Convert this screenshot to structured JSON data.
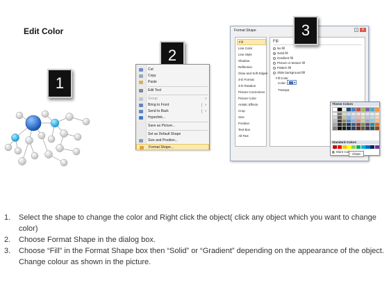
{
  "title": "Edit Color",
  "steps": [
    "1",
    "2",
    "3"
  ],
  "context_menu": {
    "items": [
      {
        "label": "Cut",
        "icon": "scissors-icon",
        "underline": "t"
      },
      {
        "label": "Copy",
        "icon": "copy-icon"
      },
      {
        "label": "Paste",
        "icon": "paste-icon"
      },
      {
        "label": "Edit Text",
        "icon": "edit-text-icon"
      },
      {
        "label": "Group",
        "icon": "group-icon",
        "submenu": true,
        "disabled": true
      },
      {
        "label": "Bring to Front",
        "icon": "bring-front-icon",
        "submenu": true
      },
      {
        "label": "Send to Back",
        "icon": "send-back-icon",
        "submenu": true
      },
      {
        "label": "Hyperlink...",
        "icon": "hyperlink-icon"
      },
      {
        "label": "Save as Picture...",
        "icon": ""
      },
      {
        "label": "Set as Default Shape",
        "icon": ""
      },
      {
        "label": "Size and Position...",
        "icon": "size-position-icon"
      },
      {
        "label": "Format Shape...",
        "icon": "format-shape-icon",
        "highlighted": true
      }
    ]
  },
  "dialog": {
    "title": "Format Shape",
    "help_label": "?",
    "close_glyph": "✕",
    "categories": [
      "Fill",
      "Line Color",
      "Line Style",
      "Shadow",
      "Reflection",
      "Glow and Soft Edges",
      "3-D Format",
      "3-D Rotation",
      "Picture Corrections",
      "Picture Color",
      "Artistic Effects",
      "Crop",
      "Size",
      "Position",
      "Text Box",
      "Alt Text"
    ],
    "selected_category": "Fill",
    "panel_heading": "Fill",
    "fill_options": [
      "No fill",
      "Solid fill",
      "Gradient fill",
      "Picture or texture fill",
      "Pattern fill",
      "Slide background fill"
    ],
    "selected_fill": "Solid fill",
    "fill_color_label": "Fill Color",
    "color_label": "Color:",
    "transparency_label": "Transpa",
    "popup": {
      "theme_colors_label": "Theme Colors",
      "standard_colors_label": "Standard Colors",
      "more_colors_label": "More Colors..."
    },
    "close_button": "Close"
  },
  "theme_colors": {
    "top": [
      "#ffffff",
      "#000000",
      "#eeece1",
      "#1f497d",
      "#4f81bd",
      "#c0504d",
      "#9bbb59",
      "#8064a2",
      "#4bacc6",
      "#f79646"
    ],
    "shades": [
      [
        "#f2f2f2",
        "#7f7f7f",
        "#ddd9c3",
        "#c6d9f0",
        "#dbe5f1",
        "#f2dcdb",
        "#ebf1dd",
        "#e5e0ec",
        "#dbeef3",
        "#fdeada"
      ],
      [
        "#d8d8d8",
        "#595959",
        "#c4bd97",
        "#8db3e2",
        "#b8cce4",
        "#e5b9b7",
        "#d7e3bc",
        "#ccc1d9",
        "#b7dde8",
        "#fbd5b5"
      ],
      [
        "#bfbfbf",
        "#3f3f3f",
        "#938953",
        "#548dd4",
        "#95b3d7",
        "#d99694",
        "#c3d69b",
        "#b2a2c7",
        "#92cddc",
        "#fac08f"
      ],
      [
        "#a5a5a5",
        "#262626",
        "#494429",
        "#17365d",
        "#366092",
        "#953734",
        "#76923c",
        "#5f497a",
        "#31859b",
        "#e36c09"
      ],
      [
        "#7f7f7f",
        "#0c0c0c",
        "#1d1b10",
        "#0f243e",
        "#244061",
        "#632423",
        "#4f6128",
        "#3f3151",
        "#205867",
        "#974806"
      ]
    ],
    "standard": [
      "#c00000",
      "#ff0000",
      "#ffc000",
      "#ffff00",
      "#92d050",
      "#00b050",
      "#00b0f0",
      "#0070c0",
      "#002060",
      "#7030a0"
    ]
  },
  "instructions": [
    {
      "num": "1.",
      "text": "Select the shape to change the color and Right click the object( click any object which you want to change color)"
    },
    {
      "num": "2.",
      "text": "Choose Format Shape in the dialog box."
    },
    {
      "num": "3.",
      "text": "Choose “Fill” in the Format Shape box then “Solid” or “Gradient” depending on the appearance of the object. Change colour as shown in the picture."
    }
  ],
  "colors": {
    "accent_blue": "#1f6fc5",
    "highlight": "#fbe9b0",
    "node_gray": "#d6d6d6"
  }
}
